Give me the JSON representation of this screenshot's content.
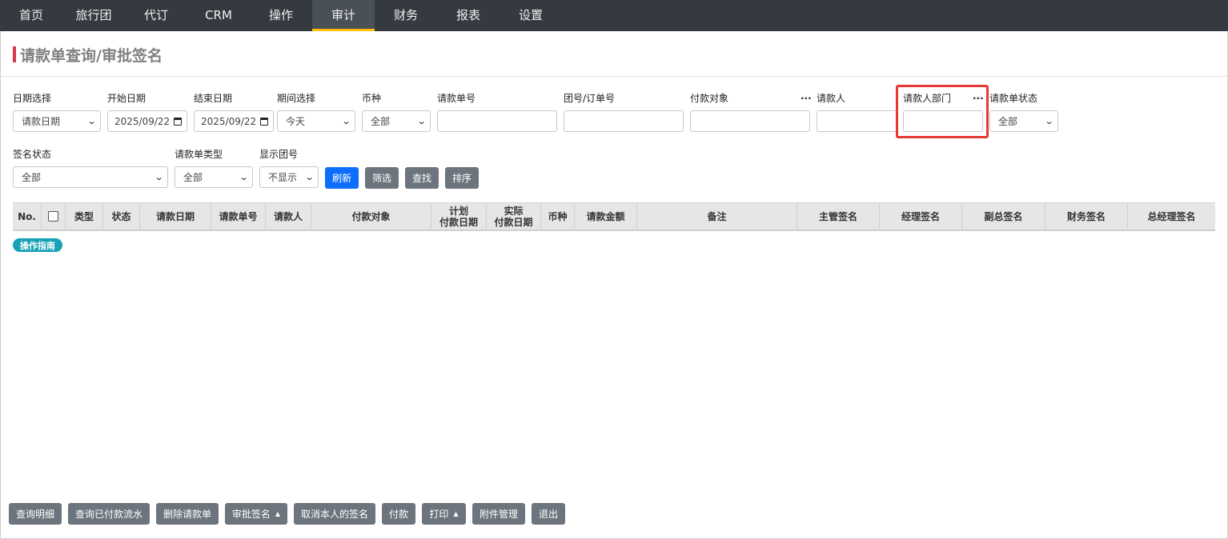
{
  "nav": {
    "items": [
      "首页",
      "旅行团",
      "代订",
      "CRM",
      "操作",
      "审计",
      "财务",
      "报表",
      "设置"
    ],
    "active_index": 5
  },
  "page": {
    "title": "请款单查询/审批签名"
  },
  "filters": {
    "date_select": {
      "label": "日期选择",
      "value": "请款日期"
    },
    "start_date": {
      "label": "开始日期",
      "value": "2025/09/22"
    },
    "end_date": {
      "label": "结束日期",
      "value": "2025/09/22"
    },
    "period": {
      "label": "期间选择",
      "value": "今天"
    },
    "currency": {
      "label": "币种",
      "value": "全部"
    },
    "request_no": {
      "label": "请款单号",
      "value": ""
    },
    "group_order_no": {
      "label": "团号/订单号",
      "value": ""
    },
    "payee": {
      "label": "付款对象",
      "value": "",
      "more": "..."
    },
    "requester": {
      "label": "请款人",
      "value": ""
    },
    "requester_dept": {
      "label": "请款人部门",
      "value": "",
      "more": "..."
    },
    "request_status": {
      "label": "请款单状态",
      "value": "全部"
    },
    "sign_status": {
      "label": "签名状态",
      "value": "全部"
    },
    "request_type": {
      "label": "请款单类型",
      "value": "全部"
    },
    "show_group_no": {
      "label": "显示团号",
      "value": "不显示"
    }
  },
  "filter_buttons": {
    "refresh": "刷新",
    "filter": "筛选",
    "search": "查找",
    "sort": "排序"
  },
  "table": {
    "headers": {
      "no": "No.",
      "type": "类型",
      "status": "状态",
      "request_date": "请款日期",
      "request_no": "请款单号",
      "requester": "请款人",
      "payee": "付款对象",
      "planned_pay_date_1": "计划",
      "planned_pay_date_2": "付款日期",
      "actual_pay_date_1": "实际",
      "actual_pay_date_2": "付款日期",
      "currency": "币种",
      "amount": "请款金额",
      "remark": "备注",
      "supervisor_sign": "主管签名",
      "manager_sign": "经理签名",
      "deputy_gm_sign": "副总签名",
      "finance_sign": "财务签名",
      "gm_sign": "总经理签名"
    }
  },
  "guide_badge": "操作指南",
  "footer_buttons": {
    "query_detail": "查询明细",
    "query_paid_flow": "查询已付款流水",
    "delete_request": "删除请款单",
    "approve_sign": "审批签名",
    "cancel_my_sign": "取消本人的签名",
    "pay": "付款",
    "print": "打印",
    "attachment": "附件管理",
    "exit": "退出"
  },
  "colors": {
    "nav_bg": "#343a40",
    "nav_active_underline": "#ffc107",
    "title_accent": "#dc3545",
    "primary": "#0d6efd",
    "secondary": "#6c757d",
    "badge": "#17a2b8",
    "highlight": "#e53935"
  }
}
